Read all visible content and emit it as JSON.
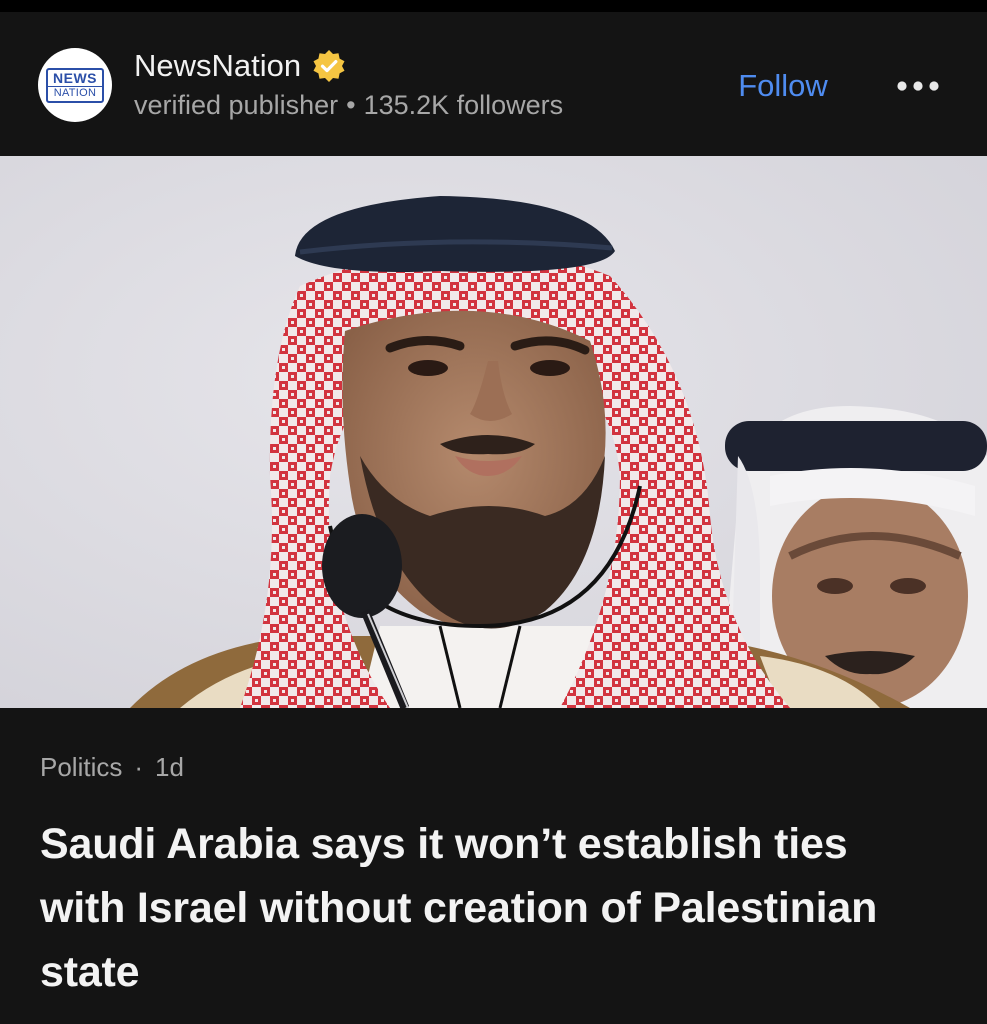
{
  "publisher": {
    "logo_top": "NEWS",
    "logo_bottom": "NATION",
    "name": "NewsNation",
    "verified_label": "verified publisher",
    "separator": "•",
    "followers": "135.2K followers",
    "follow_label": "Follow",
    "more_icon": "more-horizontal-icon",
    "verified_icon": "verified-badge-icon",
    "verified_color": "#f5c542",
    "follow_color": "#4f8cf0"
  },
  "hero_image": {
    "subject": "photo of man in red and white checkered headdress at microphone"
  },
  "article": {
    "category": "Politics",
    "separator": "·",
    "age": "1d",
    "headline": "Saudi Arabia says it won’t establish ties with Israel without creation of Palestinian state"
  },
  "colors": {
    "background": "#141414",
    "text_primary": "#f3f3f3",
    "text_secondary": "#a7a7a7"
  }
}
